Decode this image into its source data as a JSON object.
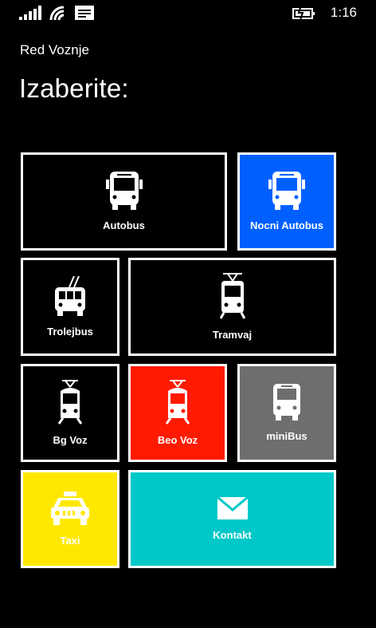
{
  "status": {
    "time": "1:16",
    "icons": [
      "signal-bars-icon",
      "wifi-icon",
      "message-icon",
      "battery-charging-icon"
    ]
  },
  "app": {
    "title": "Red Voznje"
  },
  "page": {
    "heading": "Izaberite:"
  },
  "tiles": [
    {
      "label": "Autobus",
      "icon": "bus-icon",
      "background": "#000000"
    },
    {
      "label": "Nocni Autobus",
      "icon": "bus-icon",
      "background": "#0060FF"
    },
    {
      "label": "Trolejbus",
      "icon": "trolleybus-icon",
      "background": "#000000"
    },
    {
      "label": "Tramvaj",
      "icon": "tram-icon",
      "background": "#000000"
    },
    {
      "label": "Bg Voz",
      "icon": "train-icon",
      "background": "#000000"
    },
    {
      "label": "Beo Voz",
      "icon": "train-icon",
      "background": "#FF1A00"
    },
    {
      "label": "miniBus",
      "icon": "minibus-icon",
      "background": "#6E6E6E"
    },
    {
      "label": "Taxi",
      "icon": "taxi-icon",
      "background": "#FFE800"
    },
    {
      "label": "Kontakt",
      "icon": "mail-icon",
      "background": "#00C8C8"
    }
  ]
}
